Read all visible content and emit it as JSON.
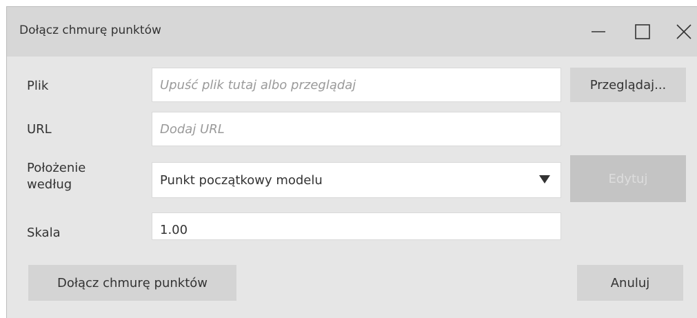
{
  "window": {
    "title": "Dołącz chmurę punktów"
  },
  "form": {
    "file": {
      "label": "Plik",
      "placeholder": "Upuść plik tutaj albo przeglądaj",
      "browse_label": "Przeglądaj..."
    },
    "url": {
      "label": "URL",
      "placeholder": "Dodaj URL"
    },
    "position": {
      "label_line1": "Położenie",
      "label_line2": "według",
      "selected": "Punkt początkowy modelu",
      "edit_label": "Edytuj"
    },
    "scale": {
      "label": "Skala",
      "value": "1.00"
    }
  },
  "footer": {
    "attach_label": "Dołącz chmurę punktów",
    "cancel_label": "Anuluj"
  },
  "icons": {
    "minimize": "minimize-icon",
    "maximize": "maximize-icon",
    "close": "close-icon",
    "dropdown": "triangle-down-icon"
  },
  "colors": {
    "titlebar": "#d7d7d7",
    "body": "#e6e6e6",
    "button": "#d4d4d4",
    "button_disabled": "#c4c4c4"
  }
}
